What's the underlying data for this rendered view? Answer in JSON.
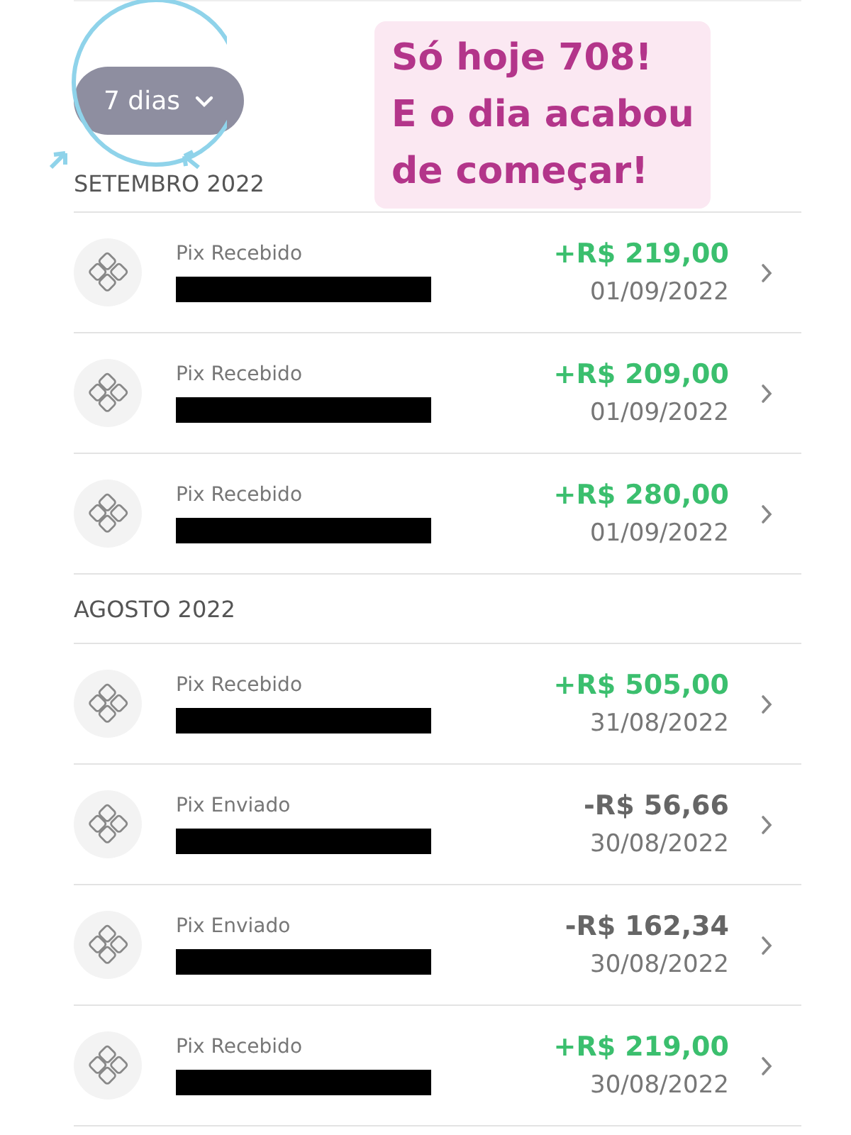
{
  "filter_button": {
    "label": "7 dias"
  },
  "note": {
    "lines": [
      "Só hoje 708!",
      "E o dia acabou",
      "de começar!"
    ]
  },
  "sections": [
    {
      "title": "SETEMBRO 2022",
      "transactions": [
        {
          "label": "Pix Recebido",
          "kind": "credit",
          "amount": "+R$ 219,00",
          "date": "01/09/2022"
        },
        {
          "label": "Pix Recebido",
          "kind": "credit",
          "amount": "+R$ 209,00",
          "date": "01/09/2022"
        },
        {
          "label": "Pix Recebido",
          "kind": "credit",
          "amount": "+R$ 280,00",
          "date": "01/09/2022"
        }
      ]
    },
    {
      "title": "AGOSTO 2022",
      "transactions": [
        {
          "label": "Pix Recebido",
          "kind": "credit",
          "amount": "+R$ 505,00",
          "date": "31/08/2022"
        },
        {
          "label": "Pix Enviado",
          "kind": "debit",
          "amount": "-R$ 56,66",
          "date": "30/08/2022"
        },
        {
          "label": "Pix Enviado",
          "kind": "debit",
          "amount": "-R$ 162,34",
          "date": "30/08/2022"
        },
        {
          "label": "Pix Recebido",
          "kind": "credit",
          "amount": "+R$ 219,00",
          "date": "30/08/2022"
        }
      ]
    }
  ]
}
